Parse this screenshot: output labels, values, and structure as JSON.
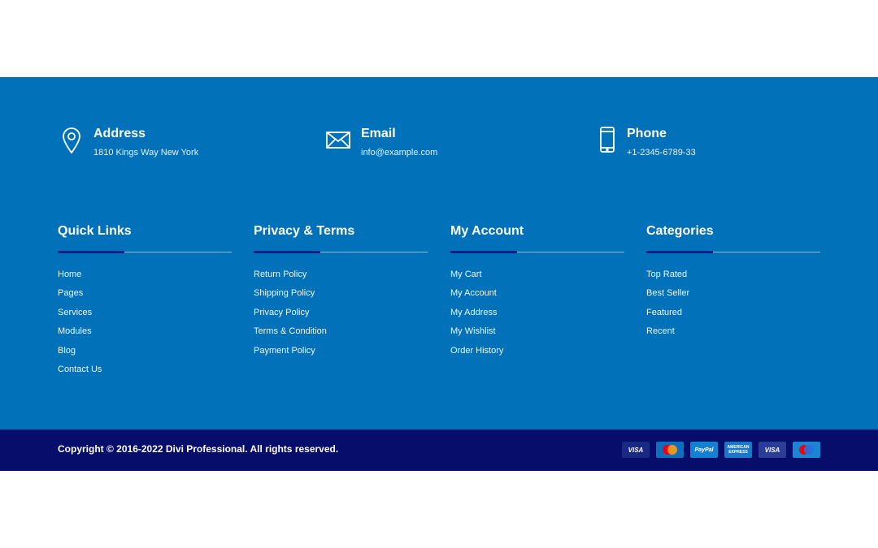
{
  "contact": {
    "address": {
      "title": "Address",
      "value": "1810 Kings Way New York"
    },
    "email": {
      "title": "Email",
      "value": "info@example.com"
    },
    "phone": {
      "title": "Phone",
      "value": "+1-2345-6789-33"
    }
  },
  "columns": [
    {
      "title": "Quick Links",
      "links": [
        "Home",
        "Pages",
        "Services",
        "Modules",
        "Blog",
        "Contact Us"
      ]
    },
    {
      "title": "Privacy & Terms",
      "links": [
        "Return Policy",
        "Shipping Policy",
        "Privacy Policy",
        "Terms & Condition",
        "Payment Policy"
      ]
    },
    {
      "title": "My Account",
      "links": [
        "My Cart",
        "My Account",
        "My Address",
        "My Wishlist",
        "Order History"
      ]
    },
    {
      "title": "Categories",
      "links": [
        "Top Rated",
        "Best Seller",
        "Featured",
        "Recent"
      ]
    }
  ],
  "bottom": {
    "copyright": "Copyright © 2016-2022 Divi Professional. All rights reserved.",
    "payments": [
      {
        "icon": "visa-card-icon",
        "label": "VISA"
      },
      {
        "icon": "mastercard-icon",
        "label": ""
      },
      {
        "icon": "paypal-icon",
        "label": "PayPal"
      },
      {
        "icon": "amex-icon",
        "label": "AMERICAN EXPRESS"
      },
      {
        "icon": "visa-card-icon",
        "label": "VISA"
      },
      {
        "icon": "maestro-icon",
        "label": ""
      }
    ]
  },
  "colors": {
    "footer_bg": "#0171b9",
    "bottom_bar_bg": "#070d6b",
    "heading_accent": "#0b1f8a"
  }
}
